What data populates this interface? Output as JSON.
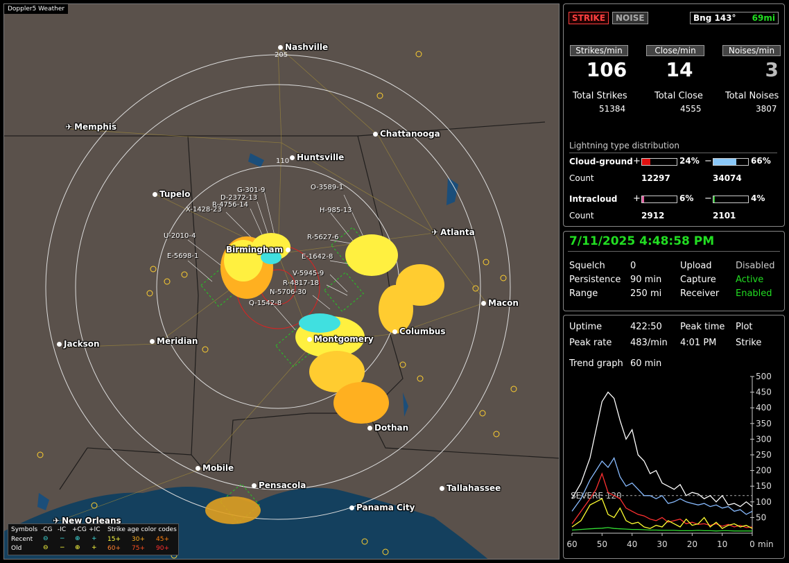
{
  "map": {
    "title": "Doppler5 Weather",
    "cities": [
      {
        "name": "Nashville",
        "icon": "dot"
      },
      {
        "name": "Memphis",
        "icon": "plane"
      },
      {
        "name": "Chattanooga",
        "icon": "dot"
      },
      {
        "name": "Huntsville",
        "icon": "dot"
      },
      {
        "name": "Tupelo",
        "icon": "dot"
      },
      {
        "name": "Atlanta",
        "icon": "plane"
      },
      {
        "name": "Birmingham",
        "icon": "dot"
      },
      {
        "name": "Macon",
        "icon": "dot"
      },
      {
        "name": "Columbus",
        "icon": "dot"
      },
      {
        "name": "Montgomery",
        "icon": "dot"
      },
      {
        "name": "Jackson",
        "icon": "dot"
      },
      {
        "name": "Meridian",
        "icon": "dot"
      },
      {
        "name": "Dothan",
        "icon": "dot"
      },
      {
        "name": "Mobile",
        "icon": "dot"
      },
      {
        "name": "Pensacola",
        "icon": "dot"
      },
      {
        "name": "Tallahassee",
        "icon": "dot"
      },
      {
        "name": "Panama City",
        "icon": "dot"
      },
      {
        "name": "New Orleans",
        "icon": "plane"
      }
    ],
    "range_labels": [
      "205",
      "110"
    ],
    "cells": [
      "G-301-9",
      "D-2372-13",
      "R-4756-14",
      "X-1428-23",
      "O-3589-1",
      "H-985-13",
      "U-2010-4",
      "R-5627-6",
      "E-5698-1",
      "E-1642-8",
      "V-5945-9",
      "R-4817-18",
      "N-5706-30",
      "Q-1542-8"
    ],
    "legend": {
      "headers": [
        "Symbols",
        "-CG",
        "-IC",
        "+CG",
        "+IC",
        "Strike age color codes"
      ],
      "row1": [
        "Recent",
        "15+",
        "30+",
        "45+"
      ],
      "row2": [
        "Old",
        "60+",
        "75+",
        "90+"
      ]
    }
  },
  "status": {
    "strike_label": "STRIKE",
    "noise_label": "NOISE",
    "bearing": "Bng 143°",
    "distance": "69mi",
    "strikes_min_label": "Strikes/min",
    "close_min_label": "Close/min",
    "noises_min_label": "Noises/min",
    "strikes_min": "106",
    "close_min": "14",
    "noises_min": "3",
    "total_strikes_label": "Total Strikes",
    "total_close_label": "Total Close",
    "total_noises_label": "Total Noises",
    "total_strikes": "51384",
    "total_close": "4555",
    "total_noises": "3807",
    "dist_title": "Lightning type distribution",
    "cg_label": "Cloud-ground",
    "ic_label": "Intracloud",
    "count_label": "Count",
    "plus": "+",
    "minus": "−",
    "cg_pos_pct": "24%",
    "cg_neg_pct": "66%",
    "cg_pos_count": "12297",
    "cg_neg_count": "34074",
    "ic_pos_pct": "6%",
    "ic_neg_pct": "4%",
    "ic_pos_count": "2912",
    "ic_neg_count": "2101",
    "cg_pos_frac": 0.24,
    "cg_neg_frac": 0.66,
    "ic_pos_frac": 0.06,
    "ic_neg_frac": 0.04
  },
  "settings": {
    "datetime": "7/11/2025 4:48:58 PM",
    "squelch_label": "Squelch",
    "squelch": "0",
    "persistence_label": "Persistence",
    "persistence": "90 min",
    "range_label": "Range",
    "range": "250 mi",
    "upload_label": "Upload",
    "upload": "Disabled",
    "capture_label": "Capture",
    "capture": "Active",
    "receiver_label": "Receiver",
    "receiver": "Enabled"
  },
  "stats": {
    "uptime_label": "Uptime",
    "uptime": "422:50",
    "peak_time_label": "Peak time",
    "peak_time": "4:01 PM",
    "plot_label": "Plot",
    "plot": "Strike",
    "peak_rate_label": "Peak rate",
    "peak_rate": "483/min",
    "trend_label": "Trend graph",
    "trend_range": "60 min",
    "severe_label": "SEVERE 120"
  },
  "chart_data": {
    "type": "line",
    "xlabel": "min",
    "x_ticks": [
      "60",
      "50",
      "40",
      "30",
      "20",
      "10",
      "0"
    ],
    "y_ticks": [
      "500",
      "450",
      "400",
      "350",
      "300",
      "250",
      "200",
      "150",
      "100",
      "50"
    ],
    "ylim": [
      0,
      500
    ],
    "xlim": [
      60,
      0
    ],
    "x": [
      60,
      57,
      54,
      52,
      50,
      48,
      46,
      44,
      42,
      40,
      38,
      36,
      34,
      32,
      30,
      28,
      26,
      24,
      22,
      20,
      18,
      16,
      14,
      12,
      10,
      8,
      6,
      4,
      2,
      0
    ],
    "series": [
      {
        "color": "#ffffff",
        "values": [
          110,
          160,
          240,
          330,
          420,
          450,
          430,
          360,
          300,
          330,
          250,
          230,
          190,
          200,
          160,
          150,
          140,
          155,
          120,
          130,
          125,
          110,
          120,
          100,
          120,
          90,
          95,
          85,
          100,
          85
        ]
      },
      {
        "color": "#88bbff",
        "values": [
          70,
          110,
          170,
          200,
          230,
          210,
          240,
          180,
          150,
          160,
          140,
          120,
          120,
          110,
          120,
          95,
          100,
          110,
          100,
          95,
          90,
          95,
          85,
          90,
          80,
          85,
          70,
          75,
          60,
          70
        ]
      },
      {
        "color": "#ff3030",
        "values": [
          30,
          70,
          110,
          140,
          190,
          130,
          120,
          110,
          80,
          70,
          60,
          55,
          45,
          40,
          50,
          35,
          40,
          45,
          30,
          35,
          28,
          30,
          25,
          30,
          22,
          28,
          20,
          25,
          18,
          20
        ]
      },
      {
        "color": "#ffff30",
        "values": [
          20,
          40,
          90,
          100,
          110,
          60,
          50,
          80,
          40,
          30,
          35,
          20,
          15,
          25,
          20,
          40,
          30,
          20,
          45,
          25,
          30,
          50,
          20,
          35,
          15,
          25,
          30,
          20,
          25,
          15
        ]
      },
      {
        "color": "#33dd33",
        "values": [
          10,
          12,
          14,
          15,
          16,
          18,
          15,
          14,
          13,
          12,
          12,
          11,
          10,
          10,
          9,
          9,
          9,
          8,
          8,
          8,
          9,
          8,
          8,
          7,
          8,
          8,
          7,
          7,
          7,
          7
        ]
      }
    ],
    "threshold": 120
  }
}
